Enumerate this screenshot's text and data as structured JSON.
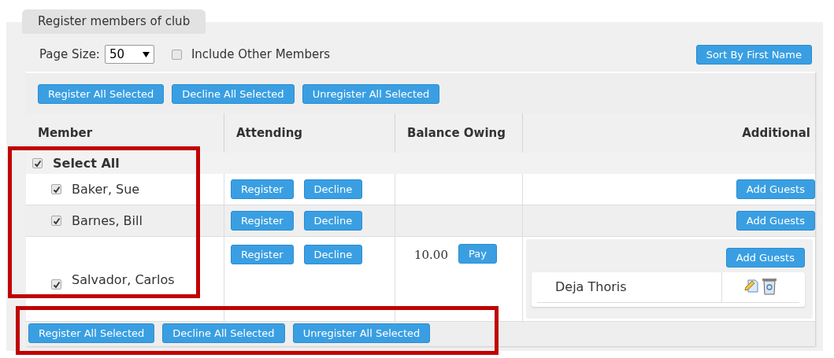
{
  "tabs": [
    {
      "label": "Register members of club",
      "selected": true
    }
  ],
  "page_size": {
    "label": "Page Size:",
    "value": "50"
  },
  "include_other": {
    "label": "Include Other Members",
    "checked": false
  },
  "sort_button": "Sort By First Name",
  "bulk_actions_top": [
    "Register All Selected",
    "Decline All Selected",
    "Unregister All Selected"
  ],
  "table": {
    "columns": [
      "Member",
      "Attending",
      "Balance Owing",
      "Additional"
    ],
    "select_all": {
      "label": "Select All",
      "checked": true
    },
    "rows": [
      {
        "member": "Baker, Sue",
        "checked": true,
        "actions": [
          "Register",
          "Decline"
        ],
        "add_button": "Add Guests"
      },
      {
        "member": "Barnes, Bill",
        "checked": true,
        "actions": [
          "Register",
          "Decline"
        ],
        "add_button": "Add Guests"
      },
      {
        "member": "Salvador, Carlos",
        "checked": true,
        "actions": [
          "Register",
          "Decline"
        ],
        "balance": "10.00",
        "pay_button": "Pay",
        "add_button": "Add Guests",
        "guests": [
          {
            "name": "Deja Thoris"
          }
        ]
      }
    ]
  },
  "bulk_actions_bottom": [
    "Register All Selected",
    "Decline All Selected",
    "Unregister All Selected"
  ]
}
